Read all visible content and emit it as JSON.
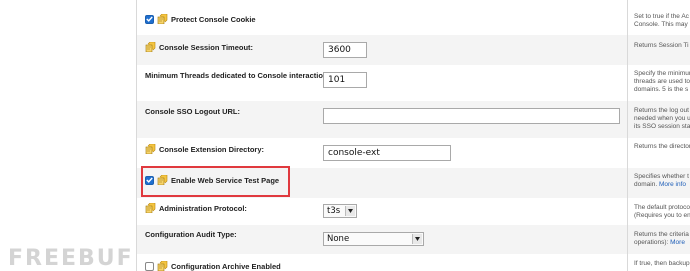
{
  "settings": [
    {
      "label": "Protect Console Cookie",
      "checkbox": true,
      "description": [
        "Set to true if the Ac",
        "Console. This may"
      ]
    },
    {
      "label": "Console Session Timeout:",
      "value": "3600",
      "description": [
        "Returns Session Ti"
      ]
    },
    {
      "label": "Minimum Threads dedicated to Console interactions:",
      "value": "101",
      "description": [
        "Specify the minimum",
        "threads are used to",
        "domains. 5 is the s"
      ]
    },
    {
      "label": "Console SSO Logout URL:",
      "value": "",
      "description": [
        "Returns the log out",
        "needed when you u",
        "its SSO session sta"
      ]
    },
    {
      "label": "Console Extension Directory:",
      "value": "console-ext",
      "description": [
        "Returns the director"
      ]
    },
    {
      "label": "Enable Web Service Test Page",
      "checkbox": true,
      "description": [
        "Specifies whether t",
        "domain."
      ],
      "link": "More info"
    },
    {
      "label": "Administration Protocol:",
      "value": "t3s",
      "description": [
        "The default protoco",
        "(Requires you to en"
      ]
    },
    {
      "label": "Configuration Audit Type:",
      "value": "None",
      "description": [
        "Returns the criteria",
        "operations):"
      ],
      "link": "More"
    },
    {
      "label": "Configuration Archive Enabled",
      "checkbox": false,
      "description": [
        "If true, then backup"
      ]
    }
  ],
  "watermark": "FREEBUF",
  "colors": {
    "highlight": "#e0393e",
    "checkbox": "#1f6fcf",
    "link": "#1f5fb8"
  }
}
